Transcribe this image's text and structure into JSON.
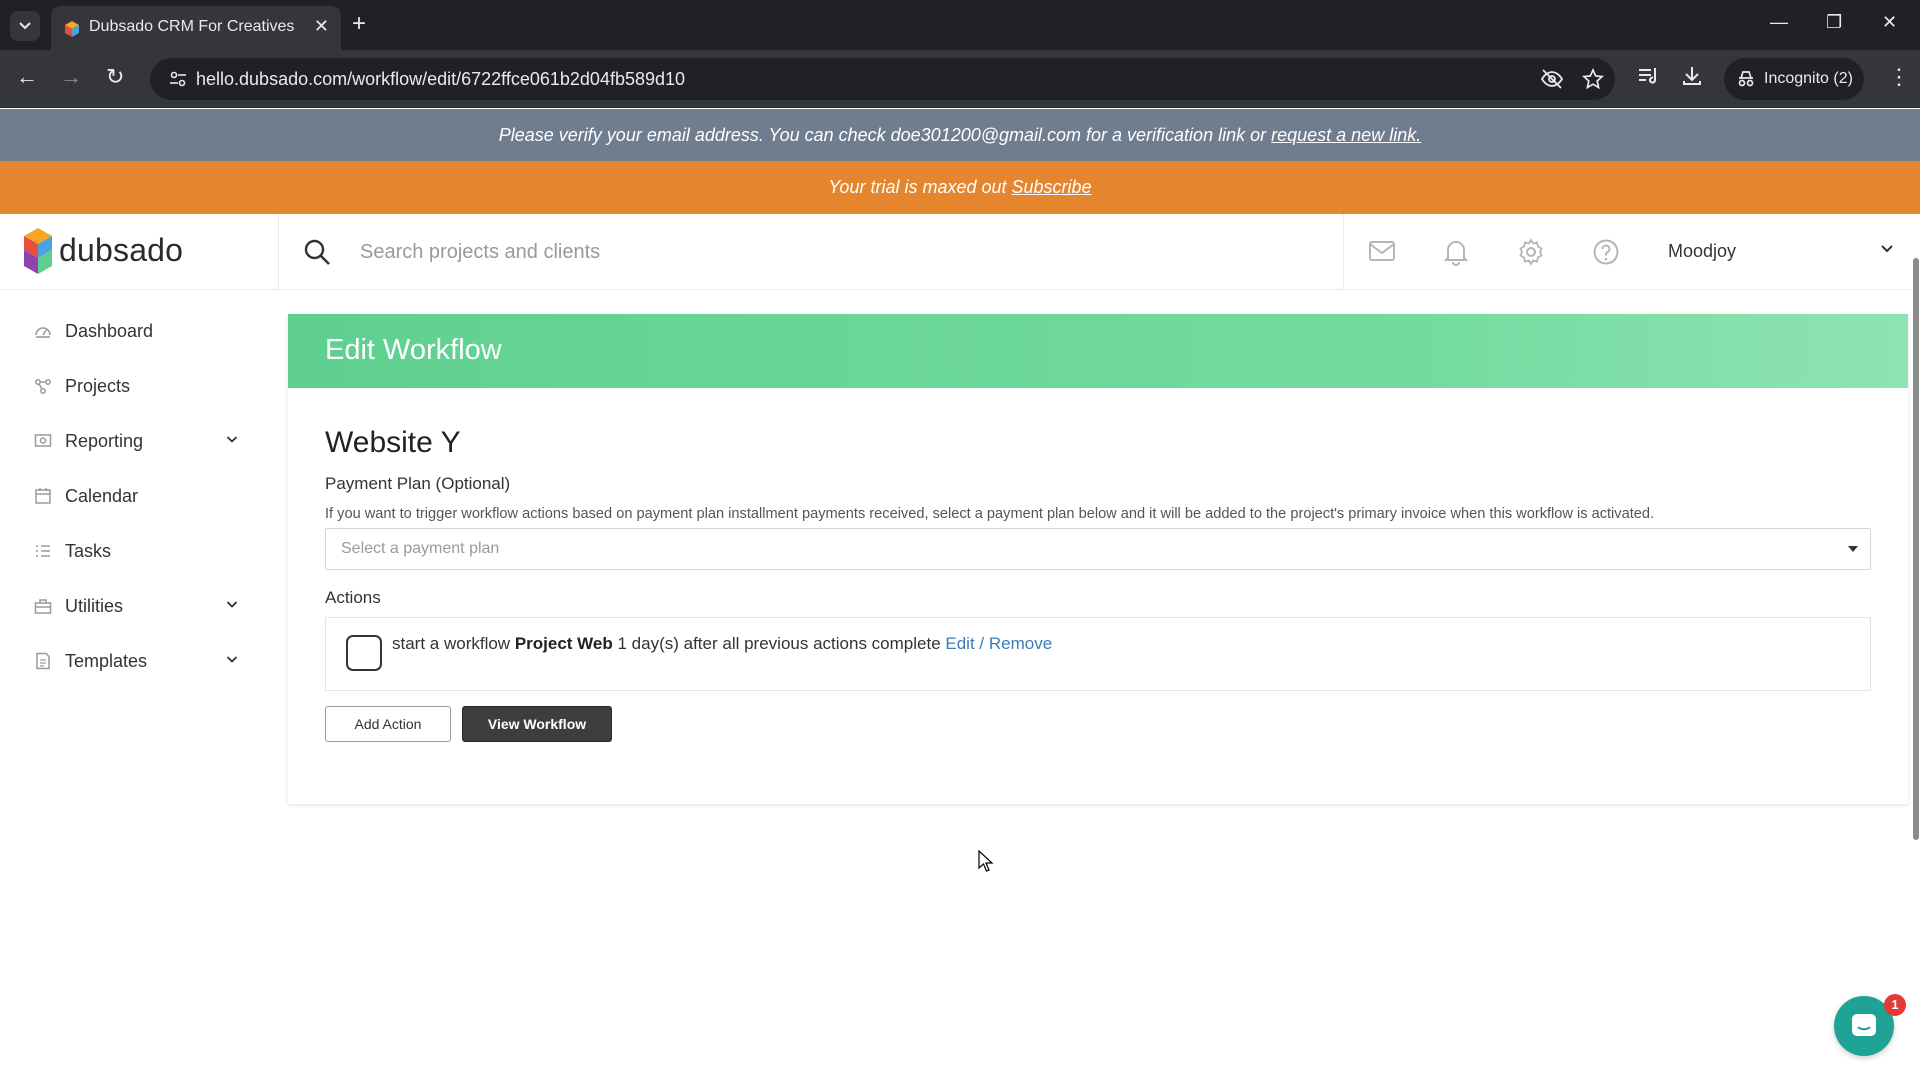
{
  "browser": {
    "tab_title": "Dubsado CRM For Creatives",
    "url": "hello.dubsado.com/workflow/edit/6722ffce061b2d04fb589d10",
    "incognito_label": "Incognito (2)"
  },
  "banners": {
    "verify_text": "Please verify your email address. You can check doe301200@gmail.com for a verification link or",
    "verify_link": "request a new link.",
    "trial_text": "Your trial is maxed out",
    "trial_link": "Subscribe"
  },
  "header": {
    "logo_text": "dubsado",
    "search_placeholder": "Search projects and clients",
    "user_name": "Moodjoy"
  },
  "sidebar": {
    "items": [
      {
        "label": "Dashboard",
        "icon": "dashboard-icon"
      },
      {
        "label": "Projects",
        "icon": "projects-icon"
      },
      {
        "label": "Reporting",
        "icon": "reporting-icon",
        "expandable": true
      },
      {
        "label": "Calendar",
        "icon": "calendar-icon"
      },
      {
        "label": "Tasks",
        "icon": "tasks-icon"
      },
      {
        "label": "Utilities",
        "icon": "utilities-icon",
        "expandable": true
      },
      {
        "label": "Templates",
        "icon": "templates-icon",
        "expandable": true
      }
    ]
  },
  "main": {
    "title": "Edit Workflow",
    "workflow_name": "Website Y",
    "payment_plan_label": "Payment Plan (Optional)",
    "payment_plan_help": "If you want to trigger workflow actions based on payment plan installment payments received, select a payment plan below and it will be added to the project's primary invoice when this workflow is activated.",
    "payment_plan_placeholder": "Select a payment plan",
    "actions_label": "Actions",
    "action": {
      "prefix": "start a workflow",
      "workflow": "Project Web",
      "suffix": "1 day(s) after all previous actions complete",
      "edit": "Edit",
      "separator": "/",
      "remove": "Remove"
    },
    "add_action_label": "Add Action",
    "view_workflow_label": "View Workflow"
  },
  "chat": {
    "badge_count": "1"
  },
  "colors": {
    "verify_banner": "#6f7d8e",
    "trial_banner": "#e5852d",
    "card_header": "#6fd89b",
    "link": "#3d7bb8",
    "chat": "#1ea394"
  }
}
